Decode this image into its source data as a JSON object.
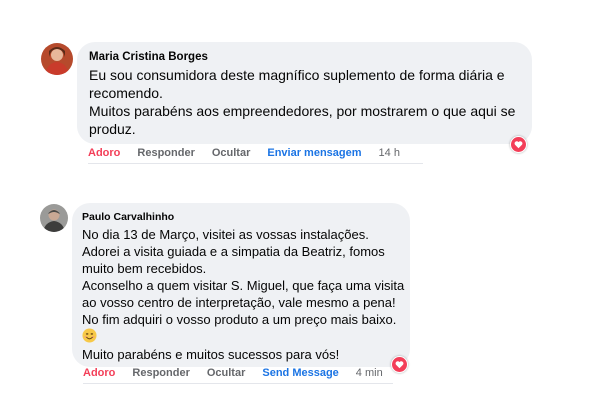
{
  "colors": {
    "bubble_bg": "#eff1f4",
    "love_red": "#f33e58",
    "link_blue": "#1b74e4",
    "muted_gray": "#65676b"
  },
  "comments": [
    {
      "author": "Maria Cristina Borges",
      "lines": [
        "Eu sou consumidora deste magnífico suplemento de forma diária e",
        "recomendo.",
        "Muitos parabéns aos empreendedores, por mostrarem o que aqui se",
        "produz."
      ],
      "actions": {
        "love": "Adoro",
        "reply": "Responder",
        "hide": "Ocultar",
        "send": "Enviar mensagem",
        "time": "14 h"
      },
      "reaction_icon": "heart-icon"
    },
    {
      "author": "Paulo Carvalhinho",
      "lines": [
        "No dia 13 de Março, visitei as vossas instalações.",
        "Adorei a visita guiada e a simpatia da Beatriz, fomos",
        "muito bem recebidos.",
        "Aconselho a quem visitar S. Miguel, que faça uma visita",
        "ao vosso centro de interpretação, vale mesmo a pena!",
        "No fim adquiri o vosso produto a um preço mais baixo."
      ],
      "emoji_icon": "smiling-face-icon",
      "closing_line": "Muito parabéns e muitos sucessos para vós!",
      "actions": {
        "love": "Adoro",
        "reply": "Responder",
        "hide": "Ocultar",
        "send": "Send Message",
        "time": "4 min"
      },
      "reaction_icon": "heart-icon"
    }
  ]
}
